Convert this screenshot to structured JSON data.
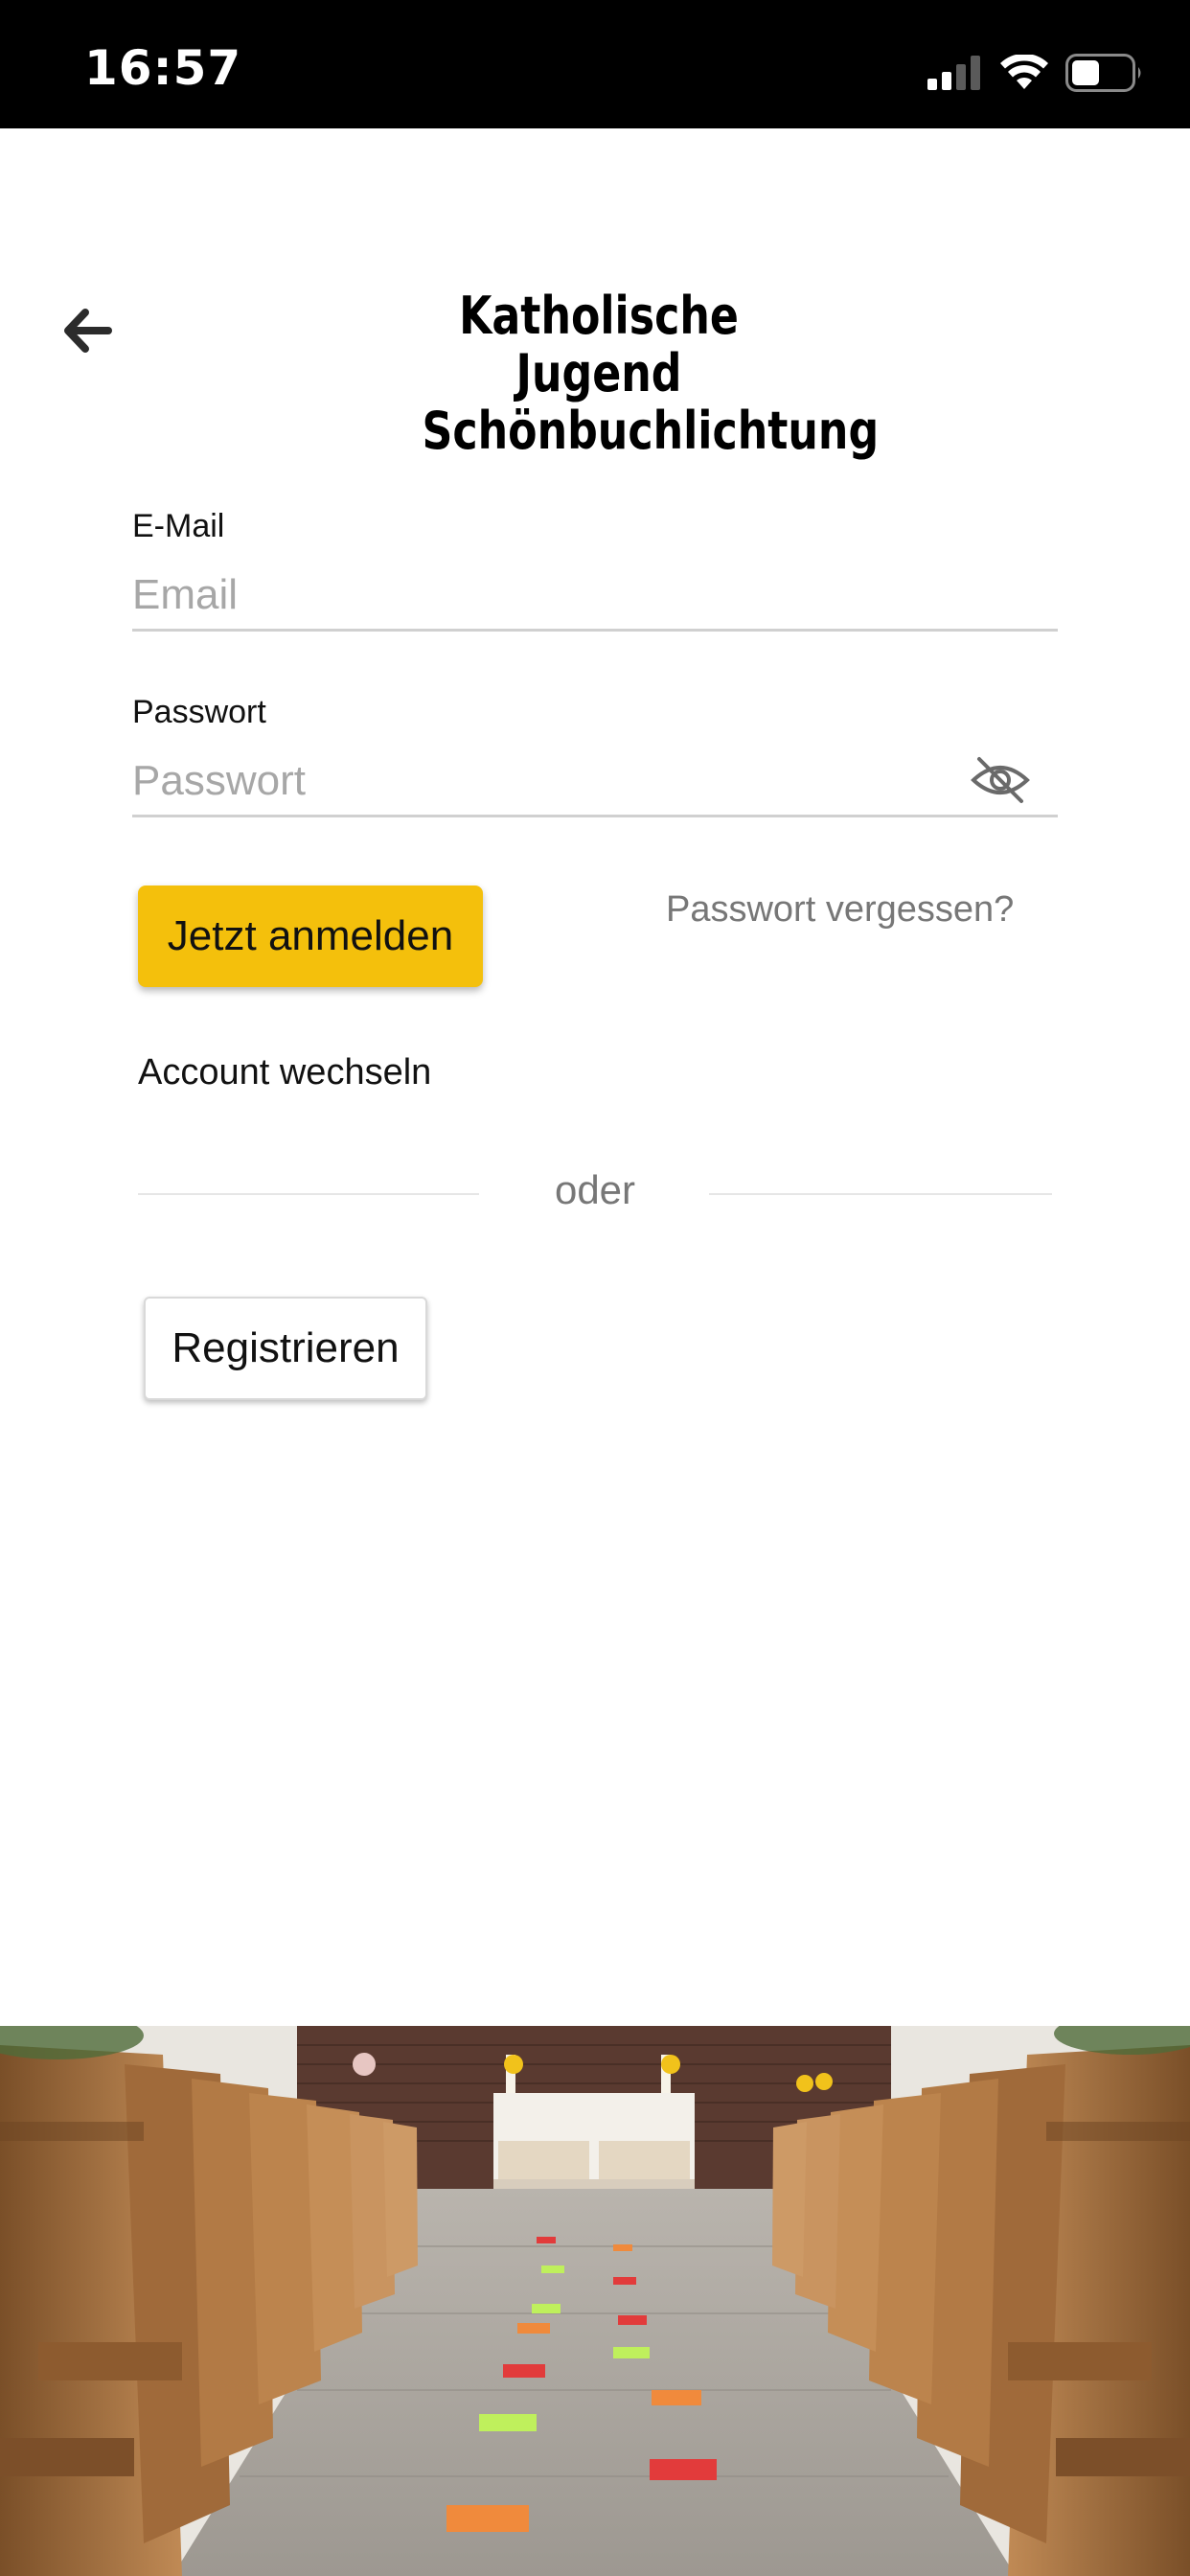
{
  "status_bar": {
    "time": "16:57",
    "icons": [
      "signal-icon",
      "wifi-icon",
      "battery-icon"
    ]
  },
  "header": {
    "back_icon": "arrow-left-icon",
    "logo_line1": "Katholische Jugend",
    "logo_line2": "Schönbuchlichtung"
  },
  "form": {
    "email": {
      "label": "E-Mail",
      "placeholder": "Email",
      "value": ""
    },
    "password": {
      "label": "Passwort",
      "placeholder": "Passwort",
      "value": "",
      "toggle_icon": "eye-slash-icon"
    },
    "login_label": "Jetzt anmelden",
    "forgot_label": "Passwort vergessen?",
    "switch_account_label": "Account wechseln",
    "divider_label": "oder",
    "register_label": "Registrieren"
  },
  "colors": {
    "accent": "#f4c00c",
    "status_bar": "#000000",
    "muted_text": "#777777",
    "placeholder": "#a7a7a7"
  },
  "footer_image": {
    "description_icon": "church-aisle-photo"
  }
}
